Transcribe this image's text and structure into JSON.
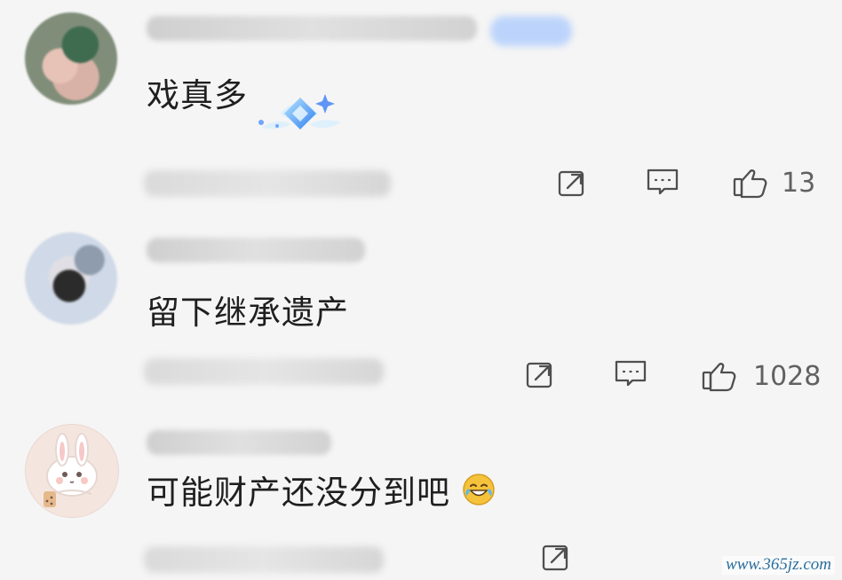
{
  "comments": [
    {
      "text": "戏真多",
      "likes": "13"
    },
    {
      "text": "留下继承遗产",
      "likes": "1028"
    },
    {
      "text": "可能财产还没分到吧"
    }
  ],
  "watermark": "www.365jz.com",
  "icons": {
    "share": "share-icon",
    "comment": "comment-icon",
    "like": "like-icon"
  },
  "colors": {
    "background": "#f5f5f5",
    "text": "#1f1f1f",
    "icon": "#4f4f4f",
    "badge": "#bcd4fb"
  }
}
